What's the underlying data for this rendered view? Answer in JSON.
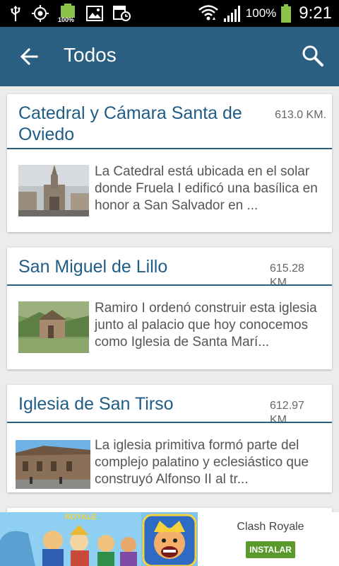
{
  "status_bar": {
    "battery_small_label": "100%",
    "battery_percent": "100%",
    "time": "9:21"
  },
  "app_bar": {
    "title": "Todos"
  },
  "places": [
    {
      "title": "Catedral y Cámara Santa de Oviedo",
      "distance": "613.0 KM.",
      "description": "La Catedral está ubicada en el solar donde Fruela I edificó una basílica en honor a San Salvador en ..."
    },
    {
      "title": "San Miguel de Lillo",
      "distance": "615.28 KM.",
      "description": "Ramiro I ordenó construir esta iglesia junto al palacio que hoy conocemos como Iglesia de Santa Marí..."
    },
    {
      "title": "Iglesia de San Tirso",
      "distance": "612.97 KM.",
      "description": "La iglesia primitiva formó parte del complejo palatino y eclesiástico que construyó Alfonso II al tr..."
    }
  ],
  "ad": {
    "art_text": "ROYALE",
    "app_name": "Clash Royale",
    "install_label": "INSTALAR"
  },
  "colors": {
    "app_bar": "#2b5f82",
    "title_text": "#1f5c86",
    "install_button": "#5a9a2c"
  }
}
